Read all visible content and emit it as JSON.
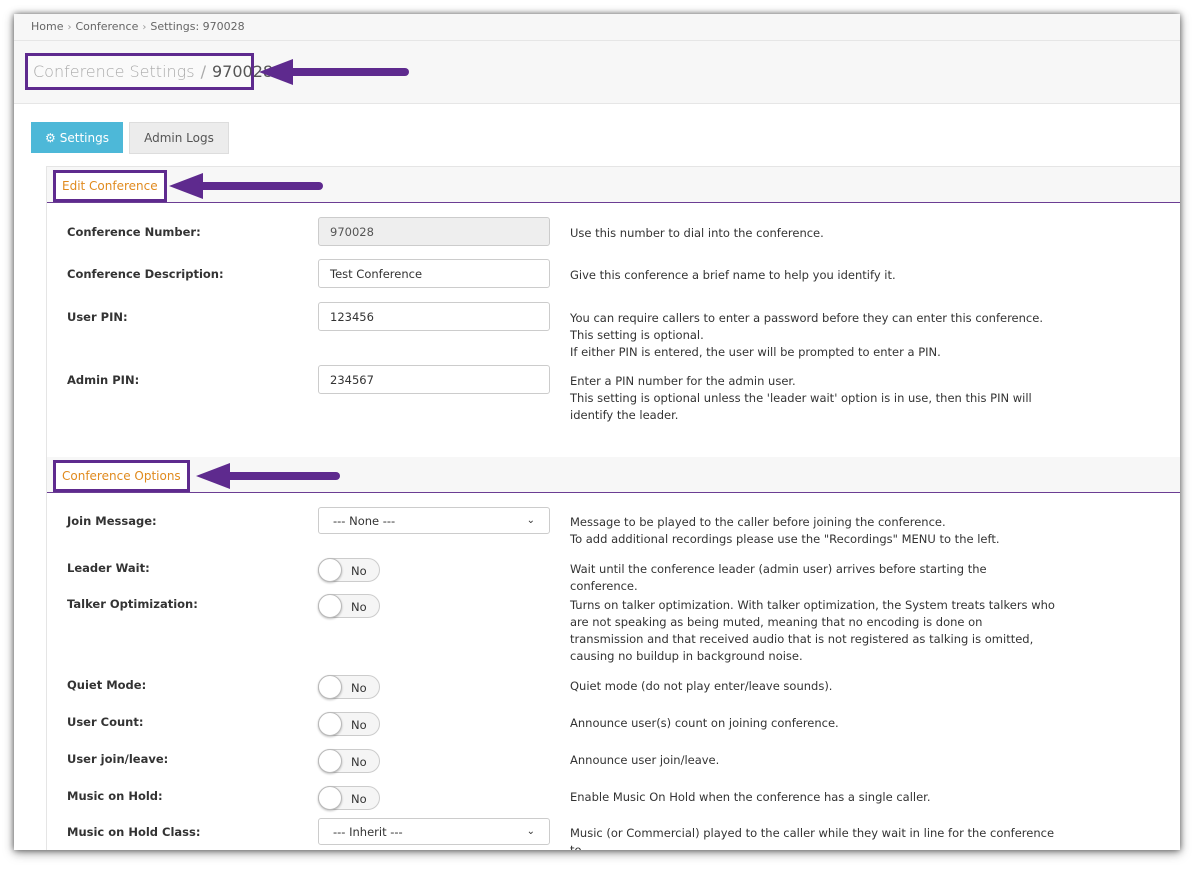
{
  "breadcrumb": [
    "Home",
    "Conference",
    "Settings: 970028"
  ],
  "page": {
    "title": "Conference Settings",
    "separator": "/",
    "number": "970028"
  },
  "tabs": {
    "settings": "Settings",
    "admin_logs": "Admin Logs"
  },
  "sections": {
    "edit": "Edit Conference",
    "options": "Conference Options"
  },
  "fields": {
    "conference_number": {
      "label": "Conference Number:",
      "value": "970028",
      "help": [
        "Use this number to dial into the conference."
      ]
    },
    "description": {
      "label": "Conference Description:",
      "value": "Test Conference",
      "help": [
        "Give this conference a brief name to help you identify it."
      ]
    },
    "user_pin": {
      "label": "User PIN:",
      "value": "123456",
      "help": [
        "You can require callers to enter a password before they can enter this conference.",
        "This setting is optional.",
        "If either PIN is entered, the user will be prompted to enter a PIN."
      ]
    },
    "admin_pin": {
      "label": "Admin PIN:",
      "value": "234567",
      "help": [
        "Enter a PIN number for the admin user.",
        "This setting is optional unless the 'leader wait' option is in use, then this PIN will identify the leader."
      ]
    }
  },
  "options": {
    "join_message": {
      "label": "Join Message:",
      "value": "--- None ---",
      "help": [
        "Message to be played to the caller before joining the conference.",
        "To add additional recordings please use the \"Recordings\" MENU to the left."
      ]
    },
    "leader_wait": {
      "label": "Leader Wait:",
      "value": "No",
      "help": [
        "Wait until the conference leader (admin user) arrives before starting the conference."
      ]
    },
    "talker_optimization": {
      "label": "Talker Optimization:",
      "value": "No",
      "help": [
        "Turns on talker optimization. With talker optimization, the System treats talkers who are not speaking as being muted, meaning that no encoding is done on transmission and that received audio that is not registered as talking is omitted, causing no buildup in background noise."
      ]
    },
    "quiet_mode": {
      "label": "Quiet Mode:",
      "value": "No",
      "help": [
        "Quiet mode (do not play enter/leave sounds)."
      ]
    },
    "user_count": {
      "label": "User Count:",
      "value": "No",
      "help": [
        "Announce user(s) count on joining conference."
      ]
    },
    "user_join_leave": {
      "label": "User join/leave:",
      "value": "No",
      "help": [
        "Announce user join/leave."
      ]
    },
    "music_on_hold": {
      "label": "Music on Hold:",
      "value": "No",
      "help": [
        "Enable Music On Hold when the conference has a single caller."
      ]
    },
    "music_on_hold_class": {
      "label": "Music on Hold Class:",
      "value": "--- Inherit ---",
      "help": [
        "Music (or Commercial) played to the caller while they wait in line for the conference to"
      ]
    }
  },
  "colors": {
    "annotation": "#5e2a8e",
    "tab_active": "#4db8d8",
    "section_label": "#e08a1e"
  },
  "icons": {
    "settings_tab": "gear-icon",
    "select": "chevron-down-icon",
    "annotation": "arrow-left-icon"
  }
}
